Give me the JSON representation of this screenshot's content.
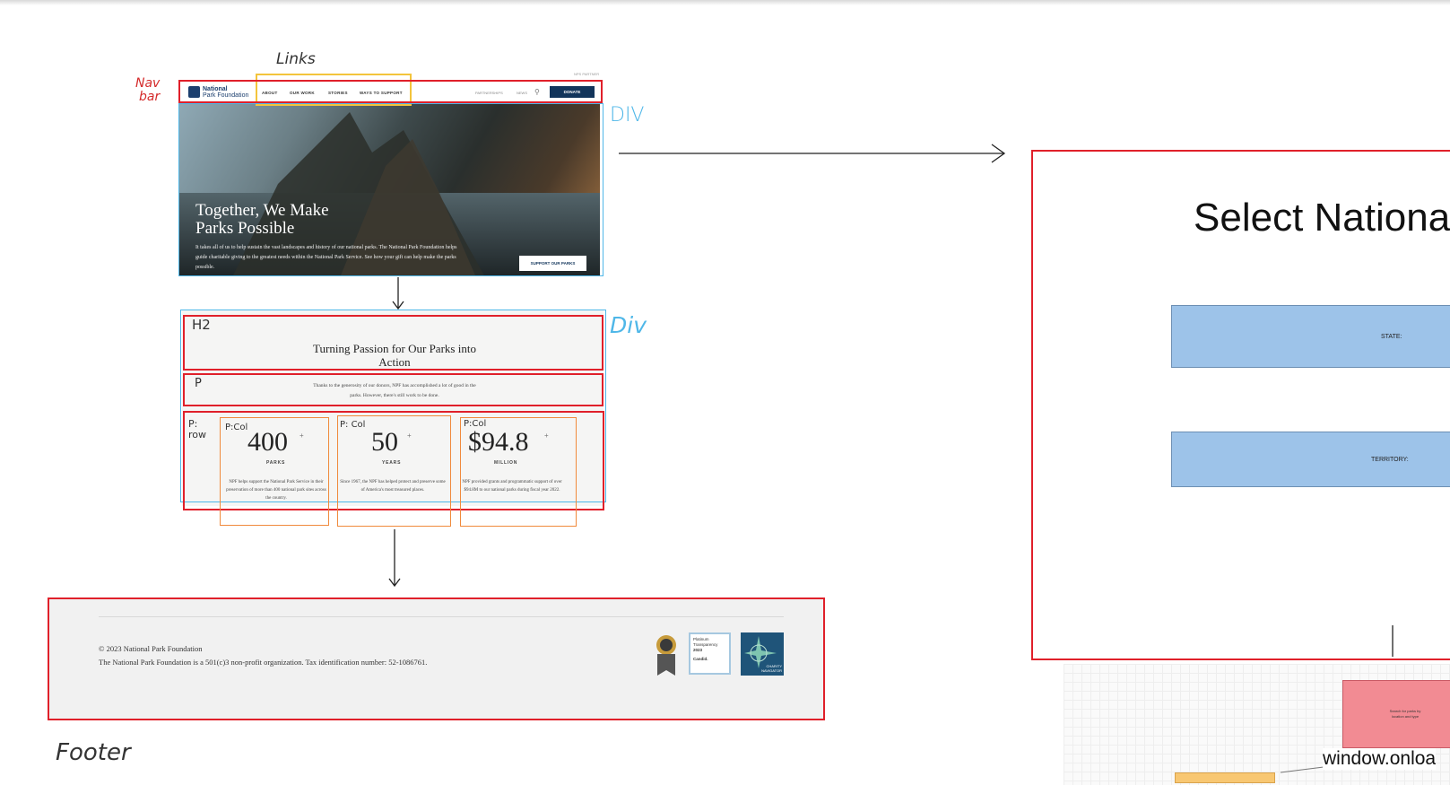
{
  "annotations": {
    "links": "Links",
    "navbar_line1": "Nav",
    "navbar_line2": "bar",
    "div_hero": "DIV",
    "div_section": "Div",
    "h2": "H2",
    "p": "P",
    "p_row_line1": "P:",
    "p_row_line2": "row",
    "col1": "P:Col",
    "col2": "P: Col",
    "col3": "P:Col",
    "footer": "Footer"
  },
  "site": {
    "logo_line1": "National",
    "logo_line2": "Park Foundation",
    "nav_links": [
      "ABOUT",
      "OUR WORK",
      "STORIES",
      "WAYS TO SUPPORT"
    ],
    "nav_right": [
      "PARTNERSHIPS",
      "NEWS"
    ],
    "top_note": "NPS PARTNER",
    "donate": "DONATE",
    "hero_title_line1": "Together, We Make",
    "hero_title_line2": "Parks Possible",
    "hero_body": "It takes all of us to help sustain the vast landscapes and history of our national parks. The National Park Foundation helps guide charitable giving to the greatest needs within the National Park Service. See how your gift can help make the parks possible.",
    "hero_button": "SUPPORT OUR PARKS",
    "section_title_line1": "Turning Passion for Our Parks into",
    "section_title_line2": "Action",
    "section_para_line1": "Thanks to the generosity of our donors, NPF has accomplished a lot of good in the",
    "section_para_line2": "parks. However, there's still work to be done.",
    "stats": [
      {
        "number": "400",
        "plus": "+",
        "label": "PARKS",
        "desc": "NPF helps support the National Park Service in their preservation of more than 400 national park sites across the country."
      },
      {
        "number": "50",
        "plus": "+",
        "label": "YEARS",
        "desc": "Since 1967, the NPF has helped protect and preserve some of America's most treasured places."
      },
      {
        "number": "$94.8",
        "plus": "+",
        "label": "MILLION",
        "desc": "NPF provided grants and programmatic support of over $94.8M to our national parks during fiscal year 2022."
      }
    ],
    "footer_copyright": "© 2023 National Park Foundation",
    "footer_tax": "The National Park Foundation is a 501(c)3 non-profit organization. Tax identification number: 52-1086761.",
    "badge_candid_lines": [
      "Platinum",
      "Transparency",
      "2023",
      "Candid."
    ],
    "badge_navigator": "CHARITY NAVIGATOR"
  },
  "wireframe": {
    "title": "Select Nationa",
    "state_label": "STATE:",
    "territory_label": "TERRITORY:",
    "search_box": "Search for parks by location and type",
    "onload": "window.onloa"
  },
  "colors": {
    "annotation_red": "#e0202a",
    "annotation_blue": "#4fb7e8",
    "annotation_orange": "#f08a3c",
    "annotation_yellow": "#f3c43c",
    "donate_navy": "#12355b",
    "wire_blue": "#9dc3e9",
    "wire_pink": "#f28b93"
  }
}
